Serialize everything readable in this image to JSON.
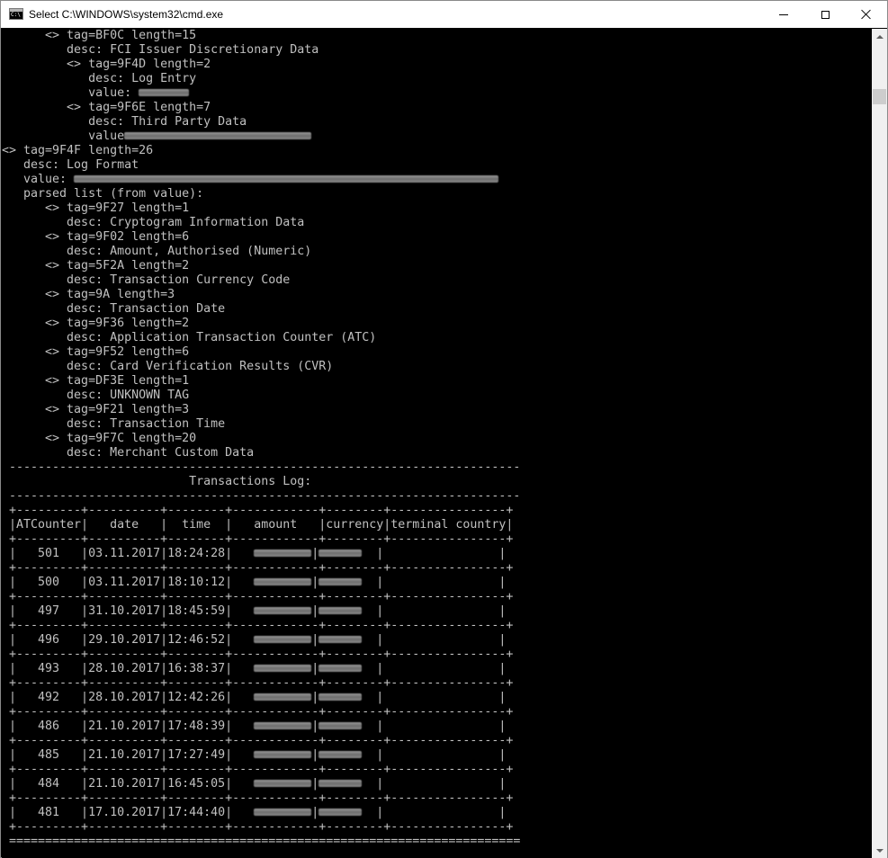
{
  "window": {
    "title": "Select C:\\WINDOWS\\system32\\cmd.exe",
    "icon": "cmd-icon",
    "icon_prompt": "C:\\",
    "controls": [
      "minimize-icon",
      "maximize-icon",
      "close-icon"
    ]
  },
  "console": {
    "lines": [
      {
        "text": "      <> tag=BF0C length=15"
      },
      {
        "text": "         desc: FCI Issuer Discretionary Data"
      },
      {
        "text": "         <> tag=9F4D length=2"
      },
      {
        "text": "            desc: Log Entry"
      },
      {
        "text": "            value: ",
        "redact": 7
      },
      {
        "text": "         <> tag=9F6E length=7"
      },
      {
        "text": "            desc: Third Party Data"
      },
      {
        "text": "            value",
        "redact": 26
      },
      {
        "text": "<> tag=9F4F length=26"
      },
      {
        "text": "   desc: Log Format"
      },
      {
        "text": "   value: ",
        "redact": 59
      },
      {
        "text": "   parsed list (from value):"
      },
      {
        "text": "      <> tag=9F27 length=1"
      },
      {
        "text": "         desc: Cryptogram Information Data"
      },
      {
        "text": "      <> tag=9F02 length=6"
      },
      {
        "text": "         desc: Amount, Authorised (Numeric)"
      },
      {
        "text": "      <> tag=5F2A length=2"
      },
      {
        "text": "         desc: Transaction Currency Code"
      },
      {
        "text": "      <> tag=9A length=3"
      },
      {
        "text": "         desc: Transaction Date"
      },
      {
        "text": "      <> tag=9F36 length=2"
      },
      {
        "text": "         desc: Application Transaction Counter (ATC)"
      },
      {
        "text": "      <> tag=9F52 length=6"
      },
      {
        "text": "         desc: Card Verification Results (CVR)"
      },
      {
        "text": "      <> tag=DF3E length=1"
      },
      {
        "text": "         desc: UNKNOWN TAG"
      },
      {
        "text": "      <> tag=9F21 length=3"
      },
      {
        "text": "         desc: Transaction Time"
      },
      {
        "text": "      <> tag=9F7C length=20"
      },
      {
        "text": "         desc: Merchant Custom Data"
      },
      {
        "text": " -----------------------------------------------------------------------"
      },
      {
        "text": "                          Transactions Log:"
      },
      {
        "text": " -----------------------------------------------------------------------"
      },
      {
        "text": " +---------+----------+--------+------------+--------+----------------+"
      },
      {
        "text": " |ATCounter|   date   |  time  |   amount   |currency|terminal country|"
      },
      {
        "text": " +---------+----------+--------+------------+--------+----------------+"
      },
      {
        "text": " |   501   |03.11.2017|18:24:28|   ",
        "redact": 8,
        "tail": "|",
        "redact2": 6,
        "tail2": "  |                |"
      },
      {
        "text": " +---------+----------+--------+------------+--------+----------------+"
      },
      {
        "text": " |   500   |03.11.2017|18:10:12|   ",
        "redact": 8,
        "tail": "|",
        "redact2": 6,
        "tail2": "  |                |"
      },
      {
        "text": " +---------+----------+--------+------------+--------+----------------+"
      },
      {
        "text": " |   497   |31.10.2017|18:45:59|   ",
        "redact": 8,
        "tail": "|",
        "redact2": 6,
        "tail2": "  |                |"
      },
      {
        "text": " +---------+----------+--------+------------+--------+----------------+"
      },
      {
        "text": " |   496   |29.10.2017|12:46:52|   ",
        "redact": 8,
        "tail": "|",
        "redact2": 6,
        "tail2": "  |                |"
      },
      {
        "text": " +---------+----------+--------+------------+--------+----------------+"
      },
      {
        "text": " |   493   |28.10.2017|16:38:37|   ",
        "redact": 8,
        "tail": "|",
        "redact2": 6,
        "tail2": "  |                |"
      },
      {
        "text": " +---------+----------+--------+------------+--------+----------------+"
      },
      {
        "text": " |   492   |28.10.2017|12:42:26|   ",
        "redact": 8,
        "tail": "|",
        "redact2": 6,
        "tail2": "  |                |"
      },
      {
        "text": " +---------+----------+--------+------------+--------+----------------+"
      },
      {
        "text": " |   486   |21.10.2017|17:48:39|   ",
        "redact": 8,
        "tail": "|",
        "redact2": 6,
        "tail2": "  |                |"
      },
      {
        "text": " +---------+----------+--------+------------+--------+----------------+"
      },
      {
        "text": " |   485   |21.10.2017|17:27:49|   ",
        "redact": 8,
        "tail": "|",
        "redact2": 6,
        "tail2": "  |                |"
      },
      {
        "text": " +---------+----------+--------+------------+--------+----------------+"
      },
      {
        "text": " |   484   |21.10.2017|16:45:05|   ",
        "redact": 8,
        "tail": "|",
        "redact2": 6,
        "tail2": "  |                |"
      },
      {
        "text": " +---------+----------+--------+------------+--------+----------------+"
      },
      {
        "text": " |   481   |17.10.2017|17:44:40|   ",
        "redact": 8,
        "tail": "|",
        "redact2": 6,
        "tail2": "  |                |"
      },
      {
        "text": " +---------+----------+--------+------------+--------+----------------+"
      },
      {
        "text": " ======================================================================="
      }
    ]
  },
  "scrollbar": {
    "up_icon": "scroll-up-arrow-icon",
    "down_icon": "scroll-down-arrow-icon"
  }
}
